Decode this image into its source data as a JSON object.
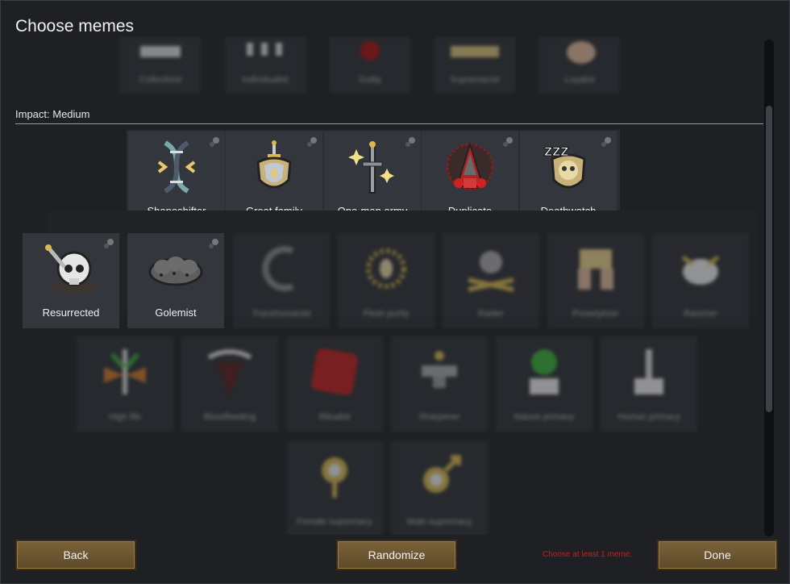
{
  "dialog": {
    "title": "Choose memes"
  },
  "top_row": {
    "memes": [
      "Collectivist",
      "Individualist",
      "Guilty",
      "Supremacist",
      "Loyalist"
    ]
  },
  "impact_medium": {
    "label": "Impact: Medium",
    "selected_row": [
      {
        "label": "Shapeshifter",
        "icon": "dna-icon"
      },
      {
        "label": "Great family",
        "icon": "family-crest-icon"
      },
      {
        "label": "One-man army",
        "icon": "sword-stars-icon"
      },
      {
        "label": "Duplicate",
        "icon": "duplicate-icon"
      },
      {
        "label": "Deathwatch",
        "icon": "sleeping-skull-icon"
      }
    ],
    "row2": [
      {
        "label": "Resurrected",
        "icon": "skull-sword-icon",
        "selected": true
      },
      {
        "label": "Golemist",
        "icon": "golem-icon",
        "selected": true
      },
      {
        "label": "Transhumanist",
        "icon": "cyber-arm-icon",
        "selected": false
      },
      {
        "label": "Flesh purity",
        "icon": "sun-flesh-icon",
        "selected": false
      },
      {
        "label": "Raider",
        "icon": "skull-bones-icon",
        "selected": false
      },
      {
        "label": "Proselytizer",
        "icon": "book-hands-icon",
        "selected": false
      },
      {
        "label": "Rancher",
        "icon": "cow-icon",
        "selected": false
      }
    ],
    "row3": [
      {
        "label": "High life",
        "icon": "leaf-icon"
      },
      {
        "label": "Bloodfeeding",
        "icon": "fangs-icon"
      },
      {
        "label": "Ritualist",
        "icon": "red-dice-icon"
      },
      {
        "label": "Sharpener",
        "icon": "anvil-icon"
      },
      {
        "label": "Nature primacy",
        "icon": "tree-pot-icon"
      },
      {
        "label": "Human primacy",
        "icon": "tower-pot-icon"
      }
    ],
    "row4": [
      {
        "label": "Female supremacy",
        "icon": "female-symbol-icon"
      },
      {
        "label": "Male supremacy",
        "icon": "male-symbol-icon"
      }
    ]
  },
  "buttons": {
    "back": "Back",
    "randomize": "Randomize",
    "done": "Done"
  },
  "warning": "Choose at least 1 meme.",
  "colors": {
    "button": "#6d5632",
    "warning": "#d01c1c",
    "panel": "#2d3035"
  }
}
